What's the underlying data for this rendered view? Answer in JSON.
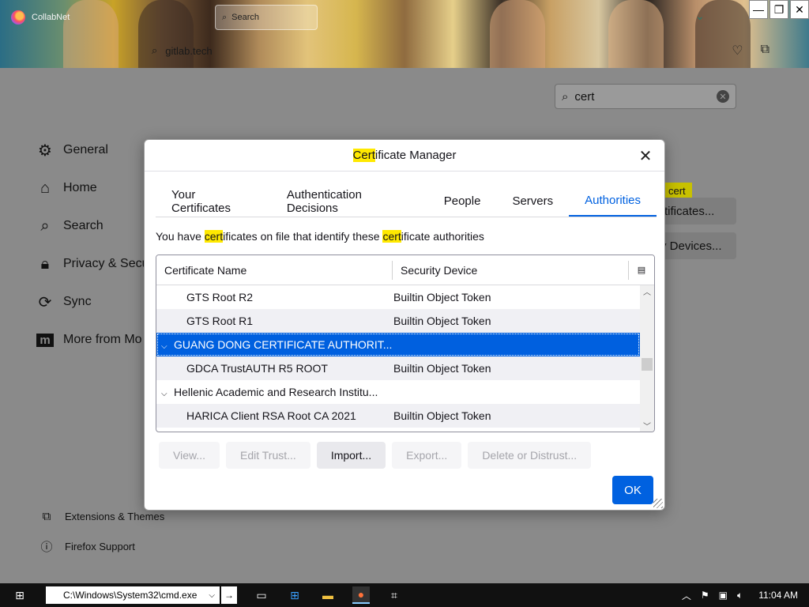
{
  "browser": {
    "tab_title": "CollabNet",
    "tab_search_label": "Search",
    "url_text": "gitlab.tech",
    "window_buttons": [
      "minimize",
      "restore",
      "close"
    ]
  },
  "settings": {
    "find_value": "cert",
    "nav": [
      {
        "label": "General",
        "icon": "gear-icon"
      },
      {
        "label": "Home",
        "icon": "home-icon"
      },
      {
        "label": "Search",
        "icon": "search-icon"
      },
      {
        "label": "Privacy & Secu",
        "icon": "lock-icon"
      },
      {
        "label": "Sync",
        "icon": "sync-icon"
      },
      {
        "label": "More from Mo",
        "icon": "mozilla-icon"
      }
    ],
    "footer": [
      {
        "label": "Extensions & Themes",
        "icon": "puzzle-icon"
      },
      {
        "label": "Firefox Support",
        "icon": "help-icon"
      }
    ],
    "highlight_badge": "cert",
    "view_certs_btn": "rtificates...",
    "security_devices_btn": "y Devices..."
  },
  "dialog": {
    "title_hl": "Cert",
    "title_rest": "ificate Manager",
    "tabs": [
      "Your Certificates",
      "Authentication Decisions",
      "People",
      "Servers",
      "Authorities"
    ],
    "active_tab": "Authorities",
    "desc_1": "You have ",
    "desc_hl1": "cert",
    "desc_2": "ificates on file that identify these ",
    "desc_hl2": "cert",
    "desc_3": "ificate authorities",
    "columns": [
      "Certificate Name",
      "Security Device"
    ],
    "rows": [
      {
        "name": "GTS Root R2",
        "device": "Builtin Object Token"
      },
      {
        "name": "GTS Root R1",
        "device": "Builtin Object Token"
      },
      {
        "name": "GUANG DONG CERTIFICATE AUTHORIT...",
        "device": ""
      },
      {
        "name": "GDCA TrustAUTH R5 ROOT",
        "device": "Builtin Object Token"
      },
      {
        "name": "Hellenic Academic and Research Institu...",
        "device": ""
      },
      {
        "name": "HARICA Client RSA Root CA 2021",
        "device": "Builtin Object Token"
      }
    ],
    "buttons": {
      "view": "View...",
      "edit_trust": "Edit Trust...",
      "import": "Import...",
      "export": "Export...",
      "delete": "Delete or Distrust..."
    },
    "ok": "OK"
  },
  "taskbar": {
    "run_value": "C:\\Windows\\System32\\cmd.exe",
    "clock": "11:04 AM"
  }
}
